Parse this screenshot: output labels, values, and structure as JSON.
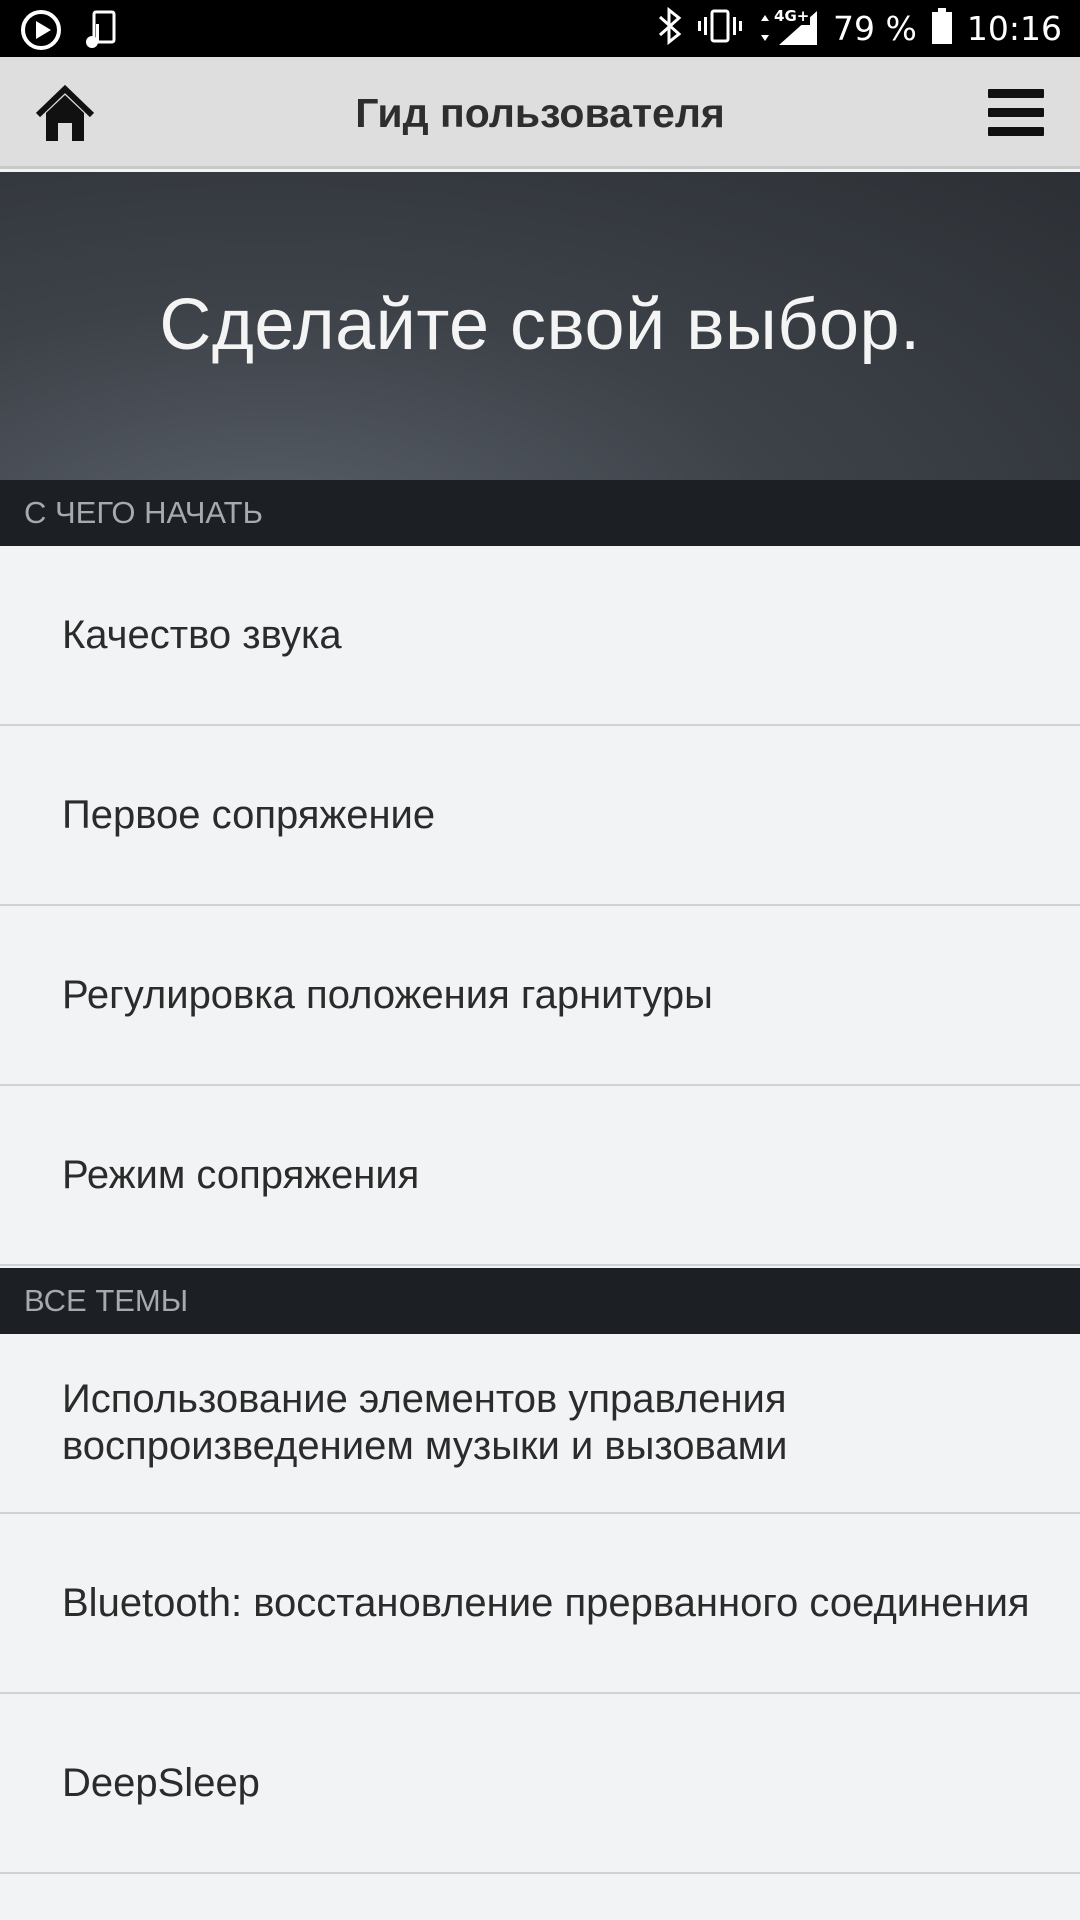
{
  "status_bar": {
    "battery_percent": "79 %",
    "time": "10:16",
    "network": "4G+"
  },
  "app_bar": {
    "title": "Гид пользователя"
  },
  "hero": {
    "text": "Сделайте свой выбор."
  },
  "sections": [
    {
      "header": "С ЧЕГО НАЧАТЬ",
      "items": [
        {
          "label": "Качество звука"
        },
        {
          "label": "Первое сопряжение"
        },
        {
          "label": "Регулировка положения гарнитуры"
        },
        {
          "label": "Режим сопряжения"
        }
      ]
    },
    {
      "header": "ВСЕ ТЕМЫ",
      "items": [
        {
          "label": "Использование элементов управления воспроизведением музыки и вызовами"
        },
        {
          "label": "Bluetooth: восстановление прерванного соединения"
        },
        {
          "label": "DeepSleep"
        }
      ]
    }
  ],
  "colors": {
    "status_bar": "#000000",
    "app_bar": "#dedede",
    "section_header": "#1c1f23",
    "list_background": "#f2f3f5"
  }
}
